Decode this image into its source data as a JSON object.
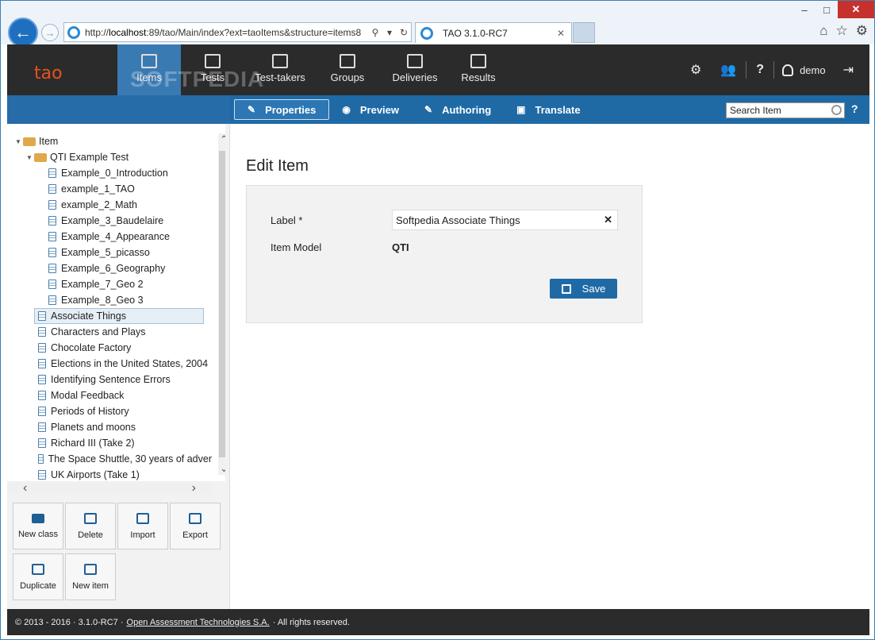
{
  "browser": {
    "url_prefix": "http://",
    "url_host": "localhost",
    "url_rest": ":89/tao/Main/index?ext=taoItems&structure=items8",
    "tab_title": "TAO 3.1.0-RC7"
  },
  "header": {
    "logo": "tao",
    "watermark": "SOFTPEDIA",
    "nav": [
      {
        "label": "Items",
        "icon": "items-icon"
      },
      {
        "label": "Tests",
        "icon": "tests-icon"
      },
      {
        "label": "Test-takers",
        "icon": "test-takers-icon"
      },
      {
        "label": "Groups",
        "icon": "groups-icon"
      },
      {
        "label": "Deliveries",
        "icon": "deliveries-icon"
      },
      {
        "label": "Results",
        "icon": "results-icon"
      }
    ],
    "user": "demo"
  },
  "actions": [
    "Properties",
    "Preview",
    "Authoring",
    "Translate"
  ],
  "search": {
    "placeholder": "Search Item"
  },
  "tree": {
    "root": "Item",
    "folder": "QTI Example Test",
    "folder_items": [
      "Example_0_Introduction",
      "example_1_TAO",
      "example_2_Math",
      "Example_3_Baudelaire",
      "Example_4_Appearance",
      "Example_5_picasso",
      "Example_6_Geography",
      "Example_7_Geo 2",
      "Example_8_Geo 3"
    ],
    "selected": "Associate Things",
    "items": [
      "Characters and Plays",
      "Chocolate Factory",
      "Elections in the United States, 2004",
      "Identifying Sentence Errors",
      "Modal Feedback",
      "Periods of History",
      "Planets and moons",
      "Richard III (Take 2)",
      "The Space Shuttle, 30 years of adver",
      "UK Airports (Take 1)"
    ]
  },
  "buttons": [
    "New class",
    "Delete",
    "Import",
    "Export",
    "Duplicate",
    "New item"
  ],
  "form": {
    "title": "Edit Item",
    "label_label": "Label *",
    "label_value": "Softpedia Associate Things",
    "model_label": "Item Model",
    "model_value": "QTI",
    "save": "Save"
  },
  "footer": {
    "prefix": "© 2013 - 2016 · 3.1.0-RC7 ·",
    "link": "Open Assessment Technologies S.A.",
    "suffix": "· All rights reserved."
  }
}
